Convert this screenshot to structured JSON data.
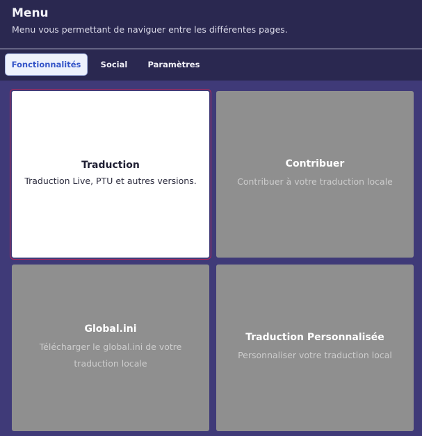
{
  "header": {
    "title": "Menu",
    "subtitle": "Menu vous permettant de naviguer entre les différentes pages."
  },
  "tabs": [
    {
      "label": "Fonctionnalités",
      "active": true
    },
    {
      "label": "Social",
      "active": false
    },
    {
      "label": "Paramètres",
      "active": false
    }
  ],
  "cards": [
    {
      "title": "Traduction",
      "description": "Traduction Live, PTU et autres versions.",
      "selected": true
    },
    {
      "title": "Contribuer",
      "description": "Contribuer à votre traduction locale",
      "selected": false
    },
    {
      "title": "Global.ini",
      "description": "Télécharger le global.ini de votre traduction locale",
      "selected": false
    },
    {
      "title": "Traduction Personnalisée",
      "description": "Personnaliser votre traduction local",
      "selected": false
    }
  ],
  "colors": {
    "background": "#29274f",
    "content_background": "#3f3a78",
    "card_default": "#8f8f8f",
    "card_selected": "#ffffff",
    "selected_outline": "#b0285a",
    "active_tab_text": "#3555c8"
  }
}
